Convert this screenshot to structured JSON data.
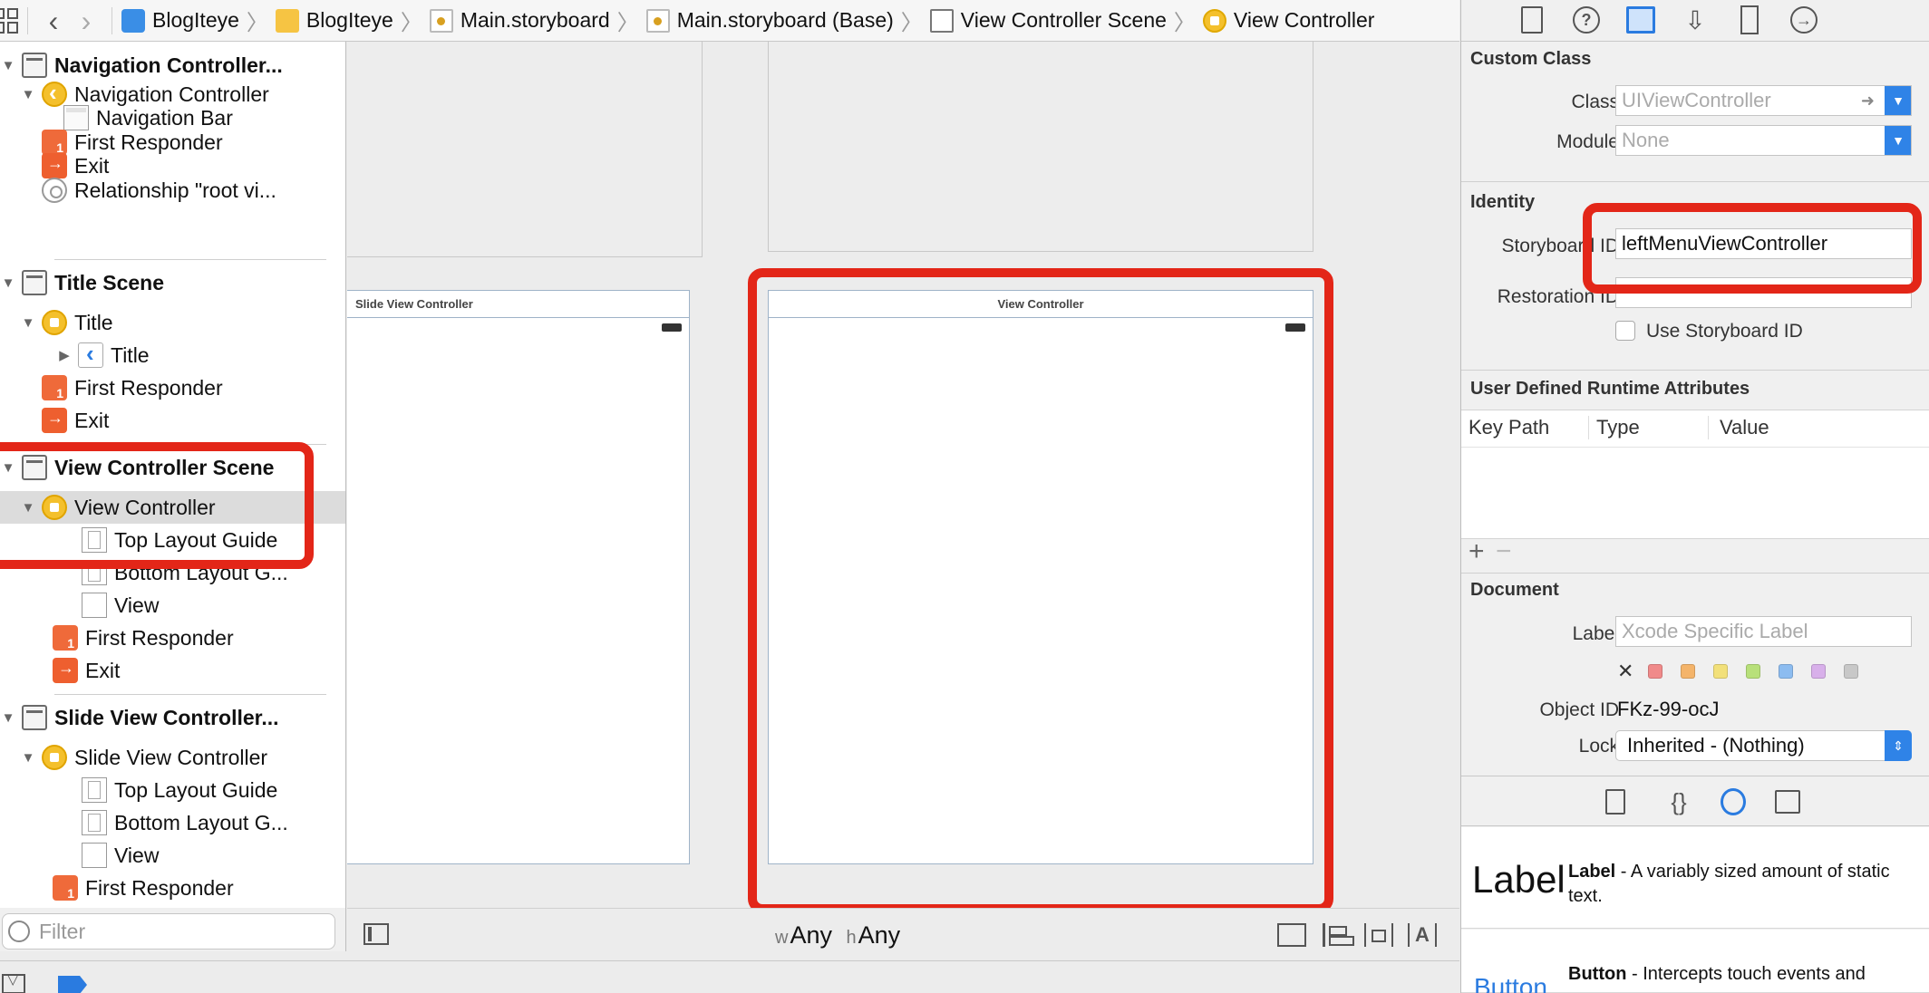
{
  "jumpbar": {
    "crumbs": [
      "BlogIteye",
      "BlogIteye",
      "Main.storyboard",
      "Main.storyboard (Base)",
      "View Controller Scene",
      "View Controller"
    ]
  },
  "outline": {
    "rows": [
      {
        "label": "Navigation Controller...",
        "icon": "scene-icon"
      },
      {
        "label": "Navigation Controller",
        "icon": "navigation-controller-icon"
      },
      {
        "label": "Navigation Bar",
        "icon": "navigation-bar-icon"
      },
      {
        "label": "First Responder",
        "icon": "first-responder-icon"
      },
      {
        "label": "Exit",
        "icon": "exit-icon"
      },
      {
        "label": "Relationship \"root vi...",
        "icon": "relationship-icon"
      },
      {
        "label": "Title Scene",
        "icon": "scene-icon"
      },
      {
        "label": "Title",
        "icon": "view-controller-icon"
      },
      {
        "label": "Title",
        "icon": "navigation-item-icon"
      },
      {
        "label": "First Responder",
        "icon": "first-responder-icon"
      },
      {
        "label": "Exit",
        "icon": "exit-icon"
      },
      {
        "label": "View Controller Scene",
        "icon": "scene-icon"
      },
      {
        "label": "View Controller",
        "icon": "view-controller-icon"
      },
      {
        "label": "Top Layout Guide",
        "icon": "layout-guide-icon"
      },
      {
        "label": "Bottom Layout G...",
        "icon": "layout-guide-icon"
      },
      {
        "label": "View",
        "icon": "view-icon"
      },
      {
        "label": "First Responder",
        "icon": "first-responder-icon"
      },
      {
        "label": "Exit",
        "icon": "exit-icon"
      },
      {
        "label": "Slide View Controller...",
        "icon": "scene-icon"
      },
      {
        "label": "Slide View Controller",
        "icon": "view-controller-icon"
      },
      {
        "label": "Top Layout Guide",
        "icon": "layout-guide-icon"
      },
      {
        "label": "Bottom Layout G...",
        "icon": "layout-guide-icon"
      },
      {
        "label": "View",
        "icon": "view-icon"
      },
      {
        "label": "First Responder",
        "icon": "first-responder-icon"
      }
    ],
    "selected_row": "View Controller",
    "filter_placeholder": "Filter"
  },
  "canvas": {
    "slide_vc_title": "Slide View Controller",
    "vc_title": "View Controller",
    "size_w_prefix": "w",
    "size_w": "Any",
    "size_h_prefix": "h",
    "size_h": "Any"
  },
  "inspector": {
    "custom_class": {
      "heading": "Custom Class",
      "class_label": "Class",
      "class_placeholder": "UIViewController",
      "module_label": "Module",
      "module_placeholder": "None"
    },
    "identity": {
      "heading": "Identity",
      "storyboard_id_label": "Storyboard ID",
      "storyboard_id_value": "leftMenuViewController",
      "restoration_id_label": "Restoration ID",
      "restoration_id_value": "",
      "use_storyboard_id_label": "Use Storyboard ID"
    },
    "udra": {
      "heading": "User Defined Runtime Attributes",
      "columns": [
        "Key Path",
        "Type",
        "Value"
      ],
      "add": "+",
      "remove": "−"
    },
    "document": {
      "heading": "Document",
      "label_label": "Label",
      "label_placeholder": "Xcode Specific Label",
      "clear_glyph": "✕",
      "swatch_colors": [
        "#f08a8a",
        "#f4b46a",
        "#f2e07a",
        "#b8e07a",
        "#8cbcf0",
        "#d8b0ea",
        "#c8c8c8"
      ],
      "object_id_label": "Object ID",
      "object_id_value": "FKz-99-ocJ",
      "lock_label": "Lock",
      "lock_value": "Inherited - (Nothing)"
    }
  },
  "library": {
    "items": [
      {
        "icon_text": "Label",
        "name": "Label",
        "desc": "A variably sized amount of static text."
      },
      {
        "icon_text": "Button",
        "name": "Button",
        "desc": "Intercepts touch events and"
      }
    ]
  },
  "colors": {
    "highlight_red": "#e32618",
    "accent_blue": "#2f83e7"
  }
}
